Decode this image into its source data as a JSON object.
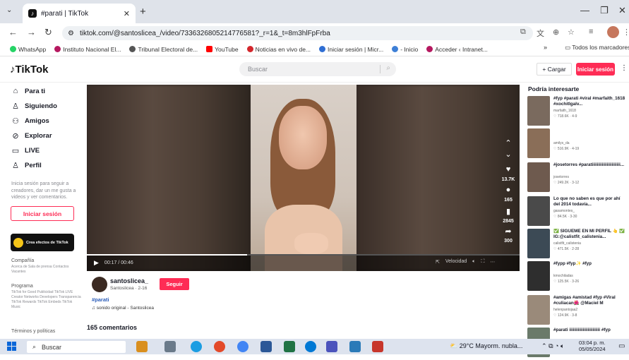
{
  "browser": {
    "tab_title": "#parati | TikTok",
    "tab_favicon": "tiktok-logo-icon",
    "url": "tiktok.com/@santoslicea_/video/7336326805214776581?_r=1&_t=8m3hlFpFrba",
    "bookmarks": [
      {
        "label": "WhatsApp",
        "color": "#25d366"
      },
      {
        "label": "Instituto Nacional El...",
        "color": "#b5185f"
      },
      {
        "label": "Tribunal Electoral de...",
        "color": "#555555"
      },
      {
        "label": "YouTube",
        "color": "#ff0000"
      },
      {
        "label": "Noticias en vivo de...",
        "color": "#d3262b"
      },
      {
        "label": "Iniciar sesión | Micr...",
        "color": "#2f6ed3"
      },
      {
        "label": "- Inicio",
        "color": "#3d7fd6"
      },
      {
        "label": "Acceder ‹ Intranet...",
        "color": "#b5185f"
      }
    ],
    "bookmarks_more": "»",
    "all_bookmarks": "Todos los marcadores"
  },
  "tiktok": {
    "logo": "TikTok",
    "search_placeholder": "Buscar",
    "upload_label": "+ Cargar",
    "login_label": "Iniciar sesión",
    "nav": [
      {
        "label": "Para ti",
        "icon": "home-icon"
      },
      {
        "label": "Siguiendo",
        "icon": "following-icon"
      },
      {
        "label": "Amigos",
        "icon": "friends-icon"
      },
      {
        "label": "Explorar",
        "icon": "explore-icon"
      },
      {
        "label": "LIVE",
        "icon": "live-icon"
      },
      {
        "label": "Perfil",
        "icon": "profile-icon"
      }
    ],
    "login_hint": "Inicia sesión para seguir a creadores, dar un me gusta a videos y ver comentarios.",
    "login_side_label": "Iniciar sesión",
    "effects_card": "Crea efectos de TikTok",
    "footer": {
      "company_h": "Compañía",
      "company_links": "Acerca de Sala de prensa Contactos Vacantes",
      "program_h": "Programa",
      "program_links": "TikTok for Good Publicidad TikTok LIVE Creator Networks Developers Transparencia TikTok Rewards TikTok Embeds TikTok Music",
      "terms_h": "Términos y políticas"
    },
    "video": {
      "likes": "13.7K",
      "comments": "165",
      "saves": "2845",
      "shares": "300",
      "time": "00:17 / 00:46",
      "progress": 0.37,
      "speed_label": "Velocidad"
    },
    "author": {
      "username": "santoslicea_",
      "subline": "Santoslicea · 2-16",
      "follow_label": "Seguir",
      "hashtag": "#parati",
      "sound": "sonido original - Santoslicea"
    },
    "comments_count": "165 comentarios",
    "suggest_title": "Podría interesarte",
    "suggestions": [
      {
        "text": "#fyp #parati #viral #marfaith_1618 #xochitlgalv...",
        "author": "marfaith_1618",
        "stats": "♡ 718.6K · 4-9",
        "color": "#7a6a5e"
      },
      {
        "text": "",
        "author": "amilys_da",
        "stats": "♡ 516.9K · 4-19",
        "color": "#8a6e58"
      },
      {
        "text": "#josetorres #paratiiiiiiiiiiiiiiiiiiiiiii...",
        "author": "josetorres",
        "stats": "♡ 249.2K · 3-12",
        "color": "#6e5a4e"
      },
      {
        "text": "Lo que no saben es que por ahí del 2014 todavía...",
        "author": "gasamontes_",
        "stats": "♡ 84.5K · 3-30",
        "color": "#4a4a4a"
      },
      {
        "text": "✅ SÍGUEME EN MI PERFIL 👆 ✅ IG:@calistfit_calistenia...",
        "author": "calistfit_calistenia",
        "stats": "♡ 471.5K · 2-28",
        "color": "#3c4a55"
      },
      {
        "text": "#fypp #fyp✨ #fyp",
        "author": "kmochiladas",
        "stats": "♡ 125.5K · 3-26",
        "color": "#2e2e2e"
      },
      {
        "text": "#amigas #amistad #fyp #Viral #culiacan🌺 @Maciel M",
        "author": "helenpantojaa2",
        "stats": "♡ 124.9K · 3-8",
        "color": "#9a8a7a"
      },
      {
        "text": "#parati iiiiiiiiiiiiiiiiiiiiiiiii #fyp",
        "author": "",
        "stats": "",
        "color": "#6a7a6a"
      }
    ]
  },
  "taskbar": {
    "search": "Buscar",
    "weather": "29°C  Mayorm. nubla...",
    "time": "03:04 p. m.",
    "date": "05/05/2024"
  }
}
